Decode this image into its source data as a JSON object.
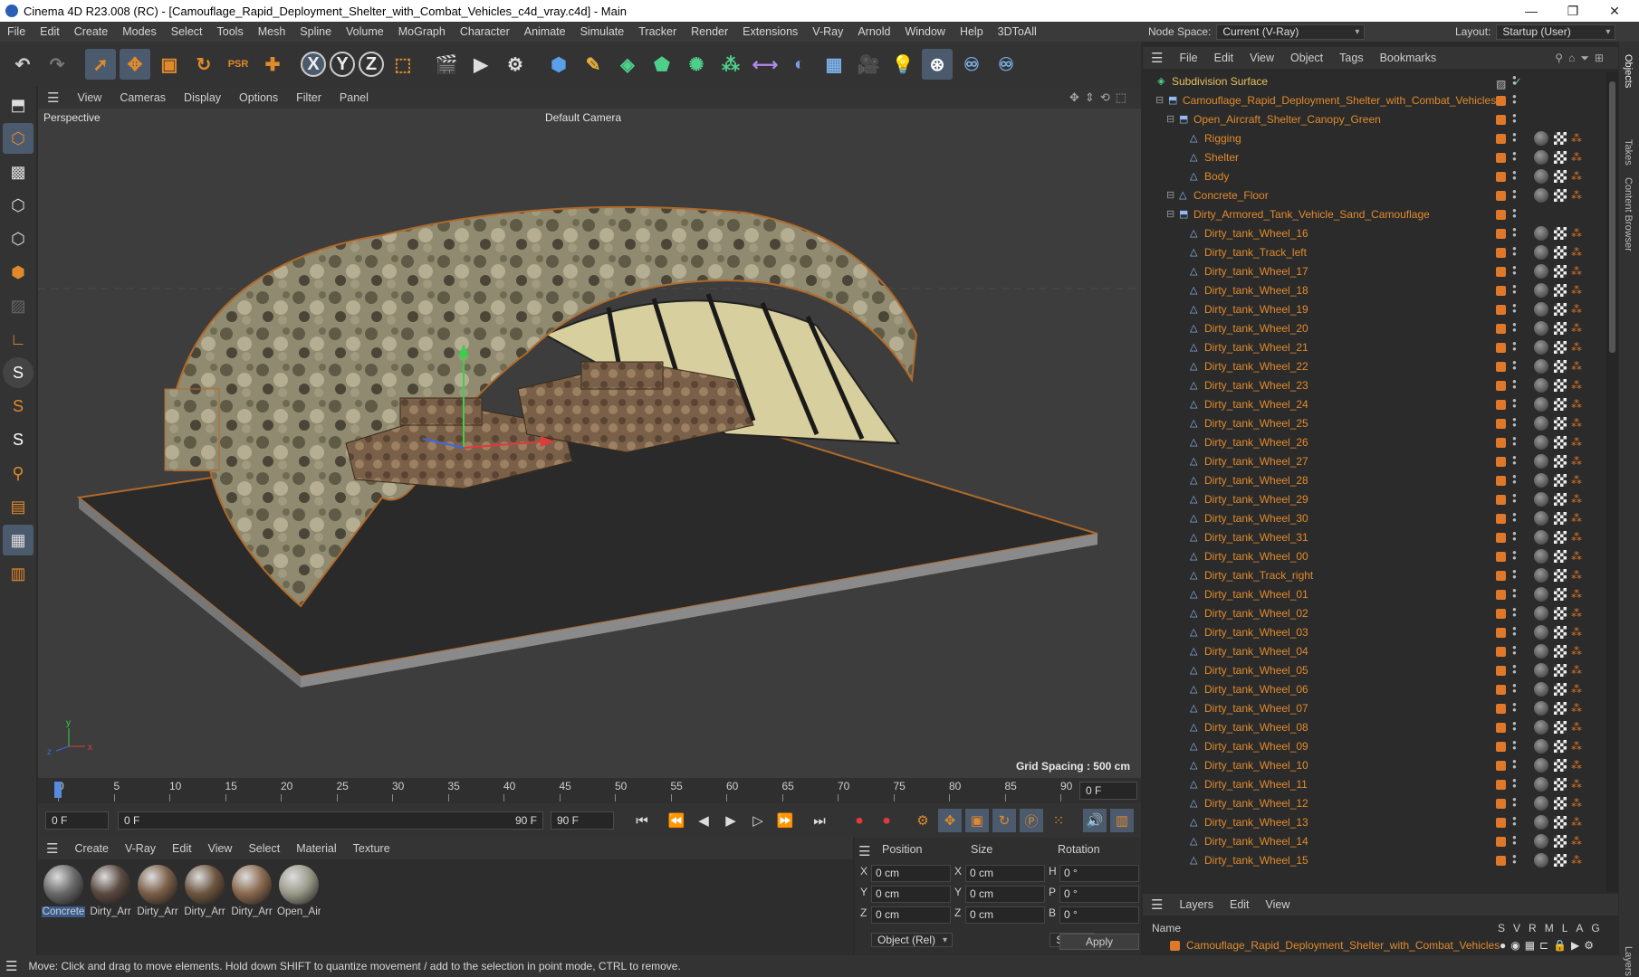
{
  "window": {
    "title": "Cinema 4D R23.008 (RC) - [Camouflage_Rapid_Deployment_Shelter_with_Combat_Vehicles_c4d_vray.c4d] - Main",
    "minimize": "—",
    "maximize": "❐",
    "close": "✕"
  },
  "menubar": {
    "items": [
      "File",
      "Edit",
      "Create",
      "Modes",
      "Select",
      "Tools",
      "Mesh",
      "Spline",
      "Volume",
      "MoGraph",
      "Character",
      "Animate",
      "Simulate",
      "Tracker",
      "Render",
      "Extensions",
      "V-Ray",
      "Arnold",
      "Window",
      "Help",
      "3DToAll"
    ],
    "node_space_label": "Node Space:",
    "node_space_value": "Current (V-Ray)",
    "layout_label": "Layout:",
    "layout_value": "Startup (User)"
  },
  "viewport": {
    "menu": [
      "View",
      "Cameras",
      "Display",
      "Options",
      "Filter",
      "Panel"
    ],
    "view_name": "Perspective",
    "camera": "Default Camera",
    "grid_spacing": "Grid Spacing : 500 cm"
  },
  "timeline": {
    "ticks": [
      "0",
      "5",
      "10",
      "15",
      "20",
      "25",
      "30",
      "35",
      "40",
      "45",
      "50",
      "55",
      "60",
      "65",
      "70",
      "75",
      "80",
      "85",
      "90"
    ],
    "current_frame_display": "0 F",
    "start_field": "0 F",
    "range_start": "0 F",
    "range_end": "90 F",
    "end_field": "90 F"
  },
  "materials": {
    "menu": [
      "Create",
      "V-Ray",
      "Edit",
      "View",
      "Select",
      "Material",
      "Texture"
    ],
    "items": [
      {
        "label": "Concrete",
        "color": "#6a6a6a"
      },
      {
        "label": "Dirty_Arr",
        "color": "#5a4a40"
      },
      {
        "label": "Dirty_Arr",
        "color": "#7a5f48"
      },
      {
        "label": "Dirty_Arr",
        "color": "#6e5640"
      },
      {
        "label": "Dirty_Arr",
        "color": "#8a6a50"
      },
      {
        "label": "Open_Air",
        "color": "#9a9a8a"
      }
    ]
  },
  "coordinates": {
    "position_label": "Position",
    "size_label": "Size",
    "rotation_label": "Rotation",
    "rows": [
      {
        "pos_axis": "X",
        "pos": "0 cm",
        "size_axis": "X",
        "size": "0 cm",
        "rot_axis": "H",
        "rot": "0 °"
      },
      {
        "pos_axis": "Y",
        "pos": "0 cm",
        "size_axis": "Y",
        "size": "0 cm",
        "rot_axis": "P",
        "rot": "0 °"
      },
      {
        "pos_axis": "Z",
        "pos": "0 cm",
        "size_axis": "Z",
        "size": "0 cm",
        "rot_axis": "B",
        "rot": "0 °"
      }
    ],
    "mode_value": "Object (Rel)",
    "size_mode_value": "Size",
    "apply_label": "Apply"
  },
  "status_text": "Move: Click and drag to move elements. Hold down SHIFT to quantize movement / add to the selection in point mode, CTRL to remove.",
  "object_manager": {
    "menu": [
      "File",
      "Edit",
      "View",
      "Object",
      "Tags",
      "Bookmarks"
    ],
    "objects": [
      {
        "name": "Subdivision Surface",
        "indent": 0,
        "tags": 0
      },
      {
        "name": "Camouflage_Rapid_Deployment_Shelter_with_Combat_Vehicles",
        "indent": 1,
        "tags": 0
      },
      {
        "name": "Open_Aircraft_Shelter_Canopy_Green",
        "indent": 2,
        "tags": 0
      },
      {
        "name": "Rigging",
        "indent": 3,
        "tags": 1
      },
      {
        "name": "Shelter",
        "indent": 3,
        "tags": 1
      },
      {
        "name": "Body",
        "indent": 3,
        "tags": 1
      },
      {
        "name": "Concrete_Floor",
        "indent": 2,
        "tags": 1
      },
      {
        "name": "Dirty_Armored_Tank_Vehicle_Sand_Camouflage",
        "indent": 2,
        "tags": 0
      },
      {
        "name": "Dirty_tank_Wheel_16",
        "indent": 3,
        "tags": 1
      },
      {
        "name": "Dirty_tank_Track_left",
        "indent": 3,
        "tags": 1
      },
      {
        "name": "Dirty_tank_Wheel_17",
        "indent": 3,
        "tags": 1
      },
      {
        "name": "Dirty_tank_Wheel_18",
        "indent": 3,
        "tags": 1
      },
      {
        "name": "Dirty_tank_Wheel_19",
        "indent": 3,
        "tags": 1
      },
      {
        "name": "Dirty_tank_Wheel_20",
        "indent": 3,
        "tags": 1
      },
      {
        "name": "Dirty_tank_Wheel_21",
        "indent": 3,
        "tags": 1
      },
      {
        "name": "Dirty_tank_Wheel_22",
        "indent": 3,
        "tags": 1
      },
      {
        "name": "Dirty_tank_Wheel_23",
        "indent": 3,
        "tags": 1
      },
      {
        "name": "Dirty_tank_Wheel_24",
        "indent": 3,
        "tags": 1
      },
      {
        "name": "Dirty_tank_Wheel_25",
        "indent": 3,
        "tags": 1
      },
      {
        "name": "Dirty_tank_Wheel_26",
        "indent": 3,
        "tags": 1
      },
      {
        "name": "Dirty_tank_Wheel_27",
        "indent": 3,
        "tags": 1
      },
      {
        "name": "Dirty_tank_Wheel_28",
        "indent": 3,
        "tags": 1
      },
      {
        "name": "Dirty_tank_Wheel_29",
        "indent": 3,
        "tags": 1
      },
      {
        "name": "Dirty_tank_Wheel_30",
        "indent": 3,
        "tags": 1
      },
      {
        "name": "Dirty_tank_Wheel_31",
        "indent": 3,
        "tags": 1
      },
      {
        "name": "Dirty_tank_Wheel_00",
        "indent": 3,
        "tags": 1
      },
      {
        "name": "Dirty_tank_Track_right",
        "indent": 3,
        "tags": 1
      },
      {
        "name": "Dirty_tank_Wheel_01",
        "indent": 3,
        "tags": 1
      },
      {
        "name": "Dirty_tank_Wheel_02",
        "indent": 3,
        "tags": 1
      },
      {
        "name": "Dirty_tank_Wheel_03",
        "indent": 3,
        "tags": 1
      },
      {
        "name": "Dirty_tank_Wheel_04",
        "indent": 3,
        "tags": 1
      },
      {
        "name": "Dirty_tank_Wheel_05",
        "indent": 3,
        "tags": 1
      },
      {
        "name": "Dirty_tank_Wheel_06",
        "indent": 3,
        "tags": 1
      },
      {
        "name": "Dirty_tank_Wheel_07",
        "indent": 3,
        "tags": 1
      },
      {
        "name": "Dirty_tank_Wheel_08",
        "indent": 3,
        "tags": 1
      },
      {
        "name": "Dirty_tank_Wheel_09",
        "indent": 3,
        "tags": 1
      },
      {
        "name": "Dirty_tank_Wheel_10",
        "indent": 3,
        "tags": 1
      },
      {
        "name": "Dirty_tank_Wheel_11",
        "indent": 3,
        "tags": 1
      },
      {
        "name": "Dirty_tank_Wheel_12",
        "indent": 3,
        "tags": 1
      },
      {
        "name": "Dirty_tank_Wheel_13",
        "indent": 3,
        "tags": 1
      },
      {
        "name": "Dirty_tank_Wheel_14",
        "indent": 3,
        "tags": 1
      },
      {
        "name": "Dirty_tank_Wheel_15",
        "indent": 3,
        "tags": 1
      }
    ]
  },
  "layers": {
    "menu": [
      "Layers",
      "Edit",
      "View"
    ],
    "name_header": "Name",
    "flags": [
      "S",
      "V",
      "R",
      "M",
      "L",
      "A",
      "G"
    ],
    "items": [
      {
        "name": "Camouflage_Rapid_Deployment_Shelter_with_Combat_Vehicles"
      }
    ]
  },
  "side_tabs": [
    "Objects",
    "Takes",
    "Content Browser",
    "Layers"
  ],
  "colors": {
    "accent": "#e0782a",
    "object_text": "#e08a2c",
    "selection": "#4c5a6e"
  }
}
